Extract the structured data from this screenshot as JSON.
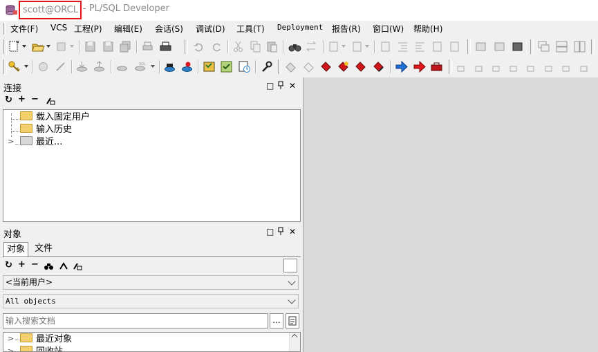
{
  "window": {
    "connection": "scott@ORCL",
    "title": " - PL/SQL Developer"
  },
  "menu": [
    "文件(F)",
    "VCS",
    "工程(P)",
    "编辑(E)",
    "会话(S)",
    "调试(D)",
    "工具(T)",
    "Deployment",
    "报告(R)",
    "窗口(W)",
    "帮助(H)"
  ],
  "connections_panel": {
    "title": "连接",
    "items": [
      "载入固定用户",
      "输入历史",
      "最近..."
    ]
  },
  "objects_panel": {
    "title": "对象",
    "tabs": [
      "对象",
      "文件"
    ],
    "user_select": "<当前用户>",
    "type_select": "All objects",
    "search_placeholder": "输入搜索文档",
    "more_label": "...",
    "items": [
      "最近对象",
      "回收站"
    ]
  },
  "panel_controls": {
    "restore": "□",
    "pin": "ꟸ",
    "close": "✕"
  },
  "colors": {
    "accent": "#e0161b",
    "title_text": "#8a8a8a",
    "workspace": "#d9d9d9"
  }
}
